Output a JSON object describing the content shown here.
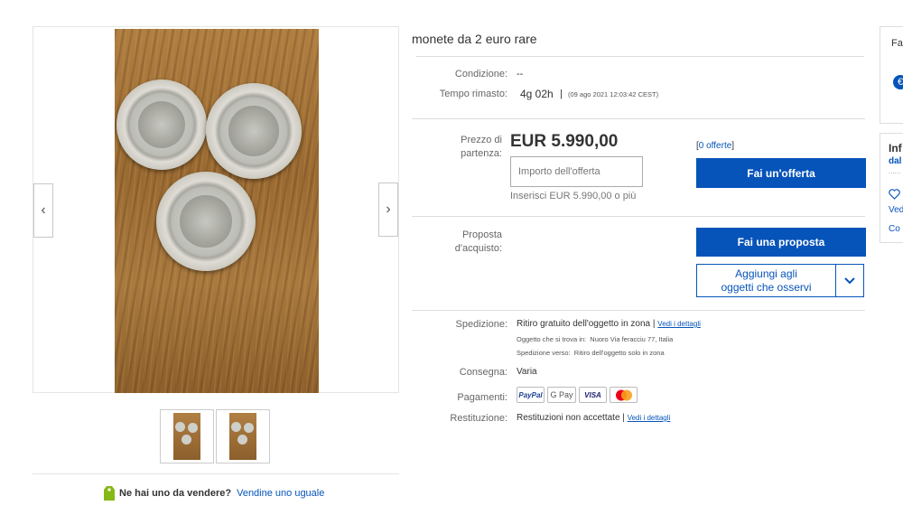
{
  "listing": {
    "title": "monete da 2 euro rare"
  },
  "gallery": {
    "prev_icon": "chevron-left-icon",
    "next_icon": "chevron-right-icon",
    "thumbnail_count": 2
  },
  "sell_prompt": {
    "question": "Ne hai uno da vendere?",
    "link": "Vendine uno uguale"
  },
  "details": {
    "condition_label": "Condizione:",
    "condition_value": "--",
    "time_label": "Tempo rimasto:",
    "time_value": "4g 02h",
    "time_separator": "|",
    "time_end": "(09 ago 2021  12:03:42 CEST)"
  },
  "bid": {
    "price_label_1": "Prezzo di",
    "price_label_2": "partenza:",
    "price": "EUR 5.990,00",
    "offers_prefix": "[",
    "offers_link": "0 offerte",
    "offers_suffix": "]",
    "input_placeholder": "Importo dell'offerta",
    "hint": "Inserisci EUR 5.990,00 o più",
    "bid_button": "Fai un'offerta"
  },
  "best_offer": {
    "label_1": "Proposta",
    "label_2": "d'acquisto:",
    "button": "Fai una proposta",
    "watch_1": "Aggiungi agli",
    "watch_2": "oggetti che osservi"
  },
  "shipping": {
    "label": "Spedizione:",
    "value": "Ritiro gratuito dell'oggetto in zona",
    "sep": "|",
    "details_link": "Vedi i dettagli",
    "location_label": "Oggetto che si trova in:",
    "location_value": "Nuoro Via feracciu 77, Italia",
    "ship_to_label": "Spedizione verso:",
    "ship_to_value": "Ritiro dell'oggetto solo in zona"
  },
  "delivery": {
    "label": "Consegna:",
    "value": "Varia"
  },
  "payments": {
    "label": "Pagamenti:",
    "methods": [
      "PayPal",
      "G Pay",
      "VISA",
      "Mastercard"
    ]
  },
  "returns": {
    "label": "Restituzione:",
    "value": "Restituzioni non accettate",
    "sep": "|",
    "details_link": "Vedi i dettagli"
  },
  "side_panel_1": {
    "title": "Fa",
    "icon": "euro-icon"
  },
  "side_panel_2": {
    "title": "Inf",
    "sub": "dal",
    "dots": "......",
    "heart_icon": "heart-icon",
    "link_1": "Ved",
    "link_2": "Co"
  },
  "colors": {
    "brand_blue": "#0654ba",
    "text": "#333333",
    "muted": "#666666"
  }
}
